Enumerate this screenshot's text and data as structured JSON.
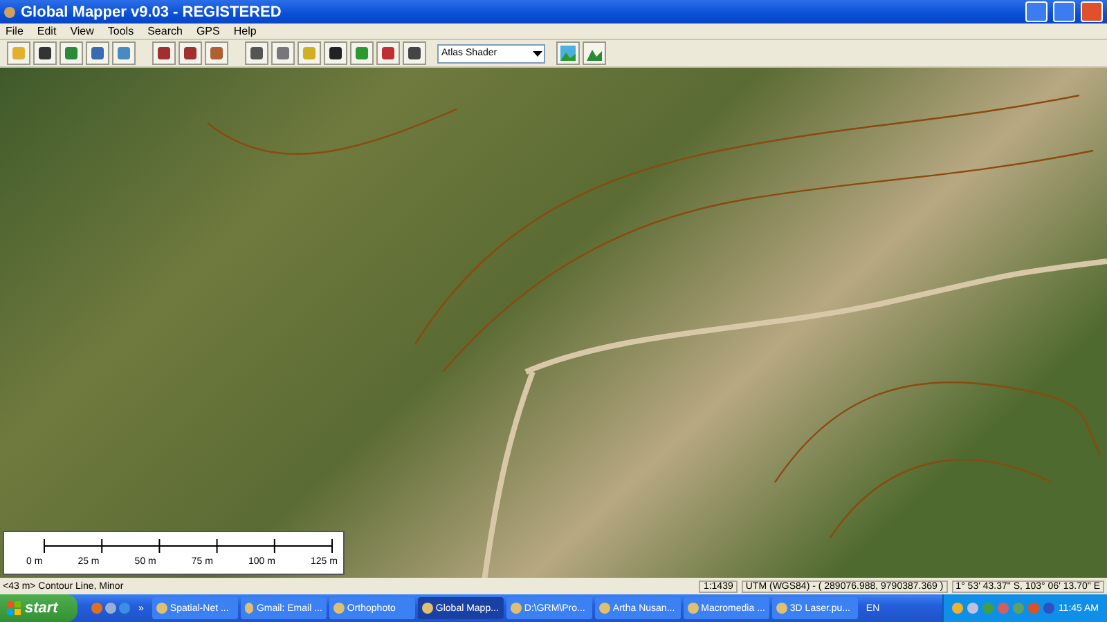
{
  "window": {
    "title": "Global Mapper v9.03 - REGISTERED"
  },
  "menu": [
    "File",
    "Edit",
    "View",
    "Tools",
    "Search",
    "GPS",
    "Help"
  ],
  "toolbar": {
    "shader": "Atlas Shader"
  },
  "scale_bar": {
    "labels": [
      "0 m",
      "25 m",
      "50 m",
      "75 m",
      "100 m",
      "125 m"
    ]
  },
  "status_bar": {
    "left": "<43 m> Contour Line, Minor",
    "scale": "1:1439",
    "projection": "UTM (WGS84) - ( 289076.988, 9790387.369 )",
    "coordinates": "1° 53' 43.37\" S, 103° 06' 13.70\" E"
  },
  "taskbar": {
    "start": "start",
    "quick_launch_more": "»",
    "items": [
      {
        "label": "Spatial-Net ...",
        "selected": false
      },
      {
        "label": "Gmail: Email ...",
        "selected": false
      },
      {
        "label": "Orthophoto",
        "selected": false
      },
      {
        "label": "Global Mapp...",
        "selected": true
      },
      {
        "label": "D:\\GRM\\Pro...",
        "selected": false
      },
      {
        "label": "Artha Nusan...",
        "selected": false
      },
      {
        "label": "Macromedia ...",
        "selected": false
      },
      {
        "label": "3D Laser.pu...",
        "selected": false
      }
    ],
    "language": "EN",
    "clock": "11:45 AM"
  }
}
